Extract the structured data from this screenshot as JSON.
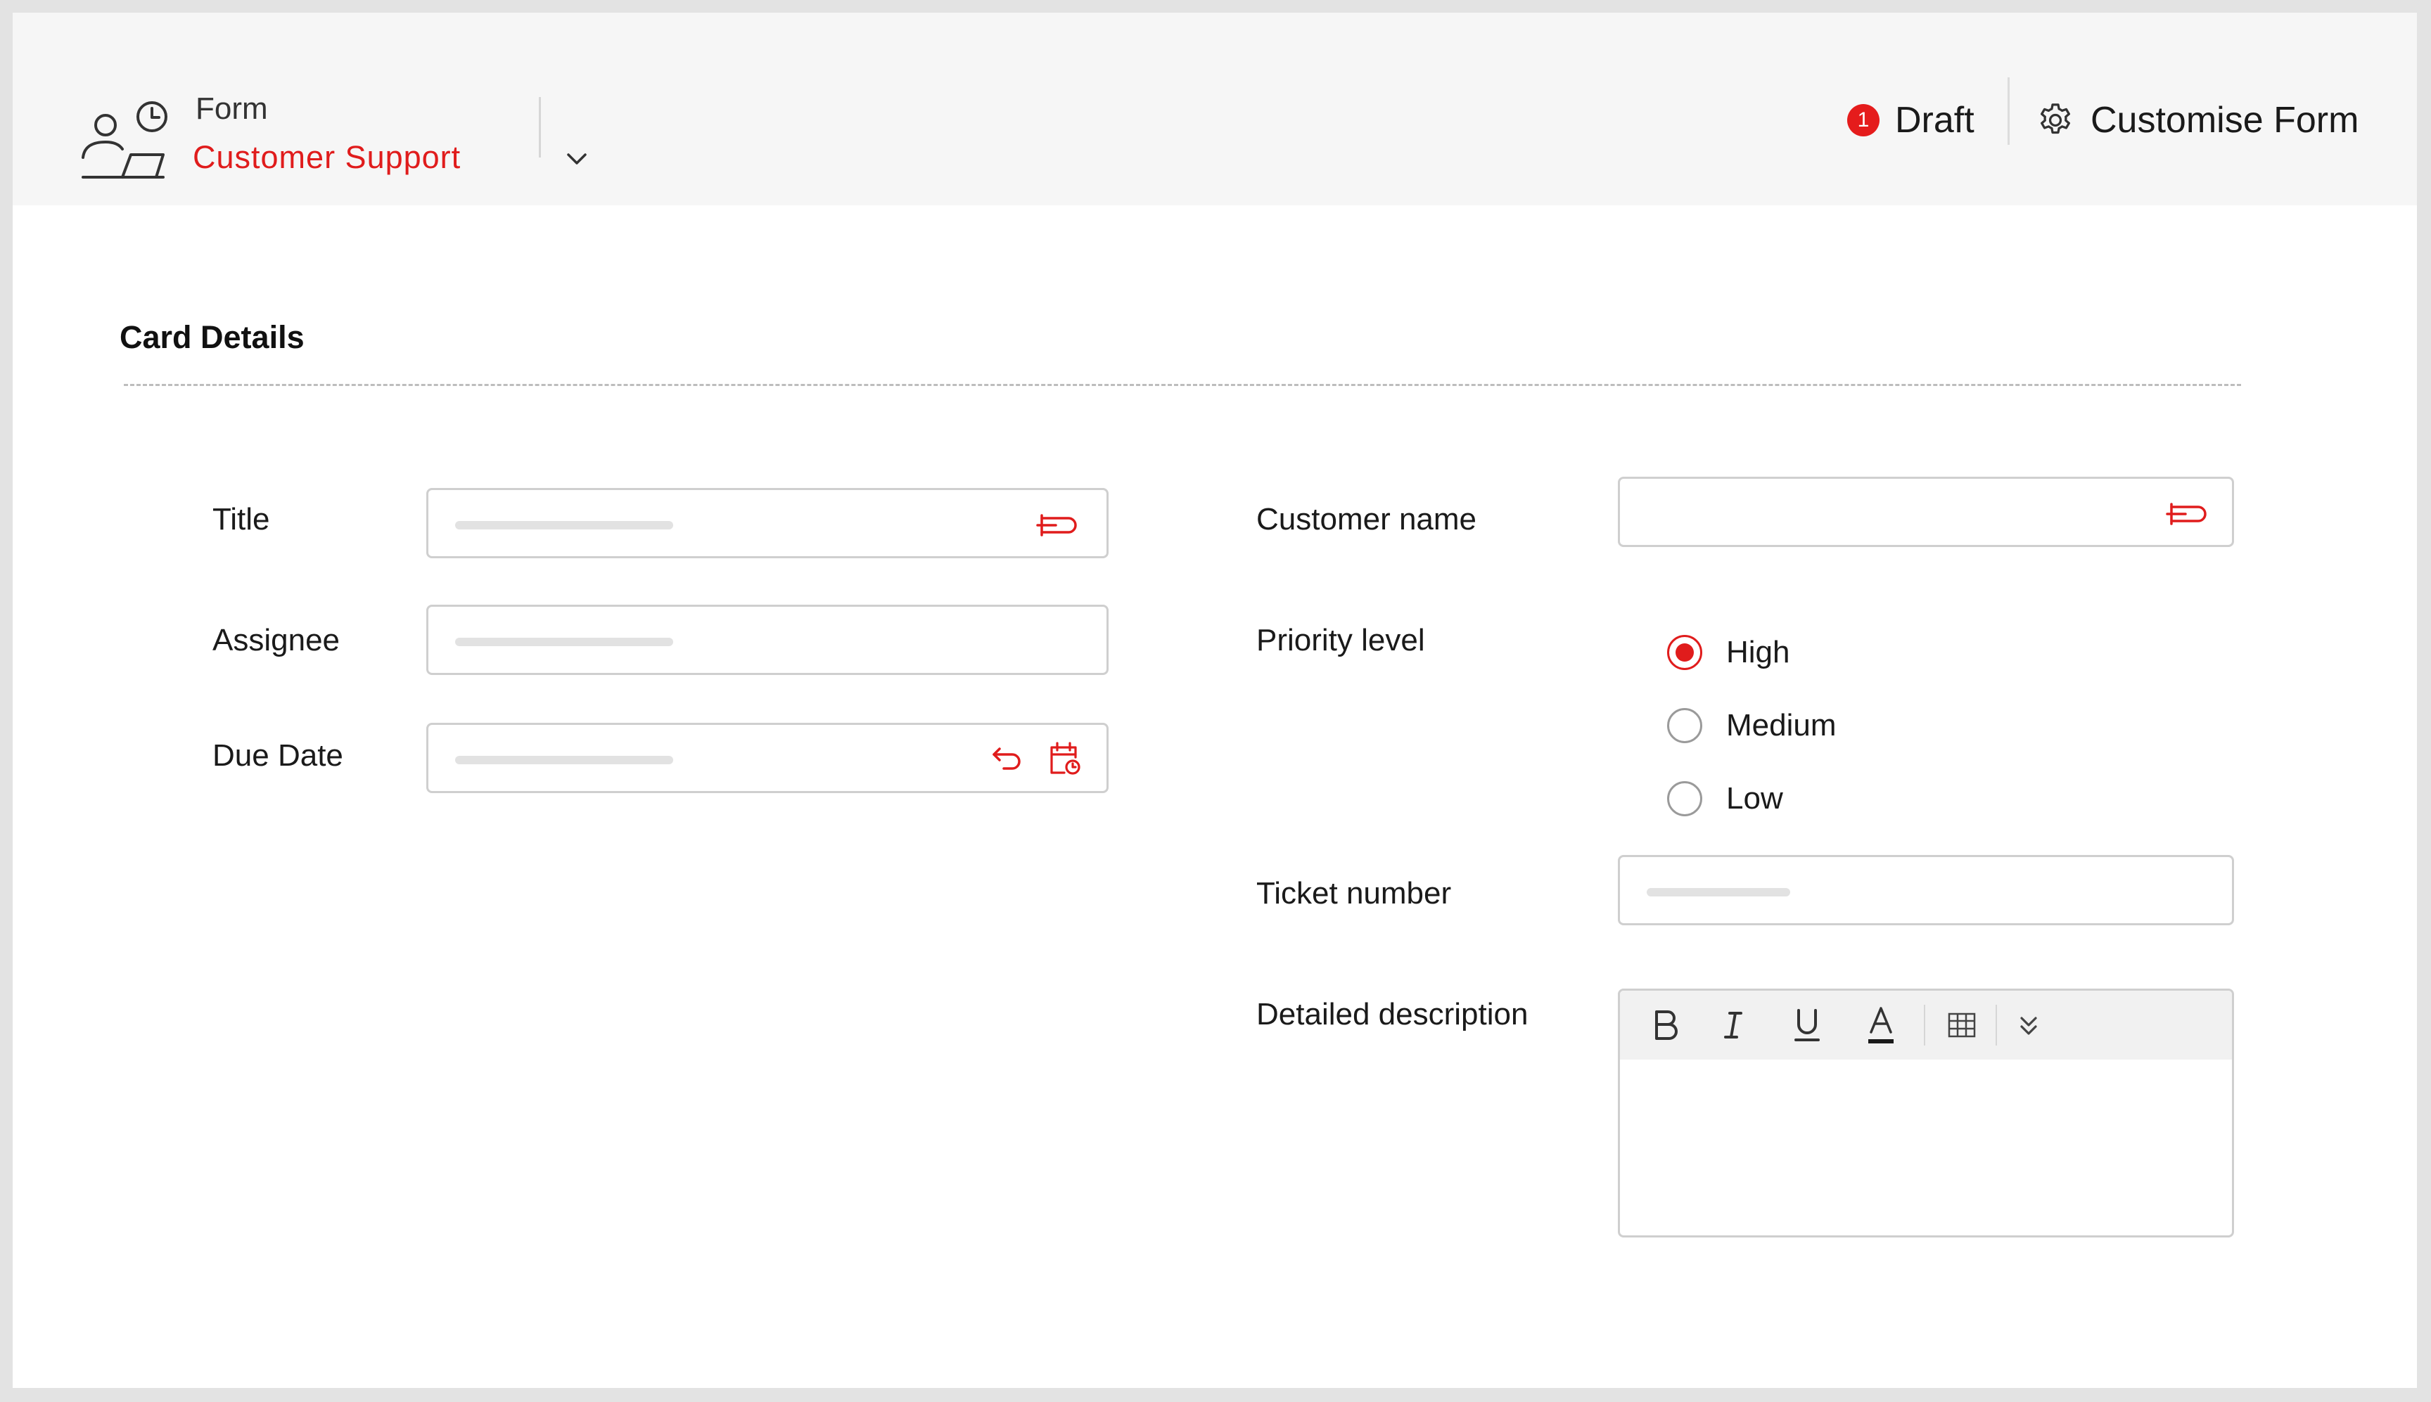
{
  "header": {
    "form_label": "Form",
    "form_name": "Customer Support",
    "draft": {
      "count": "1",
      "label": "Draft"
    },
    "customise_label": "Customise Form",
    "icons": {
      "app": "user-clock-laptop-icon",
      "dropdown": "chevron-down-icon",
      "settings": "gear-icon"
    }
  },
  "section": {
    "title": "Card Details"
  },
  "fields": {
    "title": {
      "label": "Title",
      "icon": "tag-icon"
    },
    "assignee": {
      "label": "Assignee"
    },
    "due_date": {
      "label": "Due Date",
      "icons": [
        "undo-icon",
        "calendar-clock-icon"
      ]
    },
    "customer_name": {
      "label": "Customer name",
      "icon": "tag-icon"
    },
    "priority_level": {
      "label": "Priority level",
      "options": [
        "High",
        "Medium",
        "Low"
      ],
      "selected": "High"
    },
    "ticket_number": {
      "label": "Ticket number"
    },
    "detailed_description": {
      "label": "Detailed description",
      "toolbar": [
        "bold",
        "italic",
        "underline",
        "font-color",
        "table",
        "more"
      ]
    }
  },
  "colors": {
    "accent": "#e01c1c",
    "header_bg": "#f6f6f6",
    "border": "#cfcfcf"
  }
}
